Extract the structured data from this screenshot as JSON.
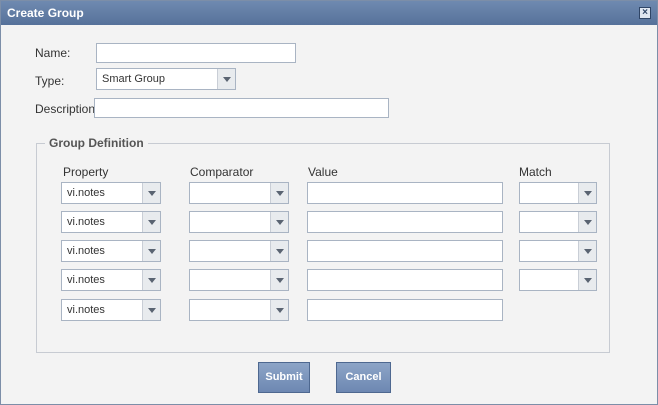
{
  "dialog": {
    "title": "Create Group",
    "close_icon": "close-icon"
  },
  "form": {
    "name_label": "Name:",
    "name_value": "",
    "type_label": "Type:",
    "type_value": "Smart Group",
    "description_label": "Description",
    "description_value": ""
  },
  "group_definition": {
    "legend": "Group Definition",
    "headers": {
      "property": "Property",
      "comparator": "Comparator",
      "value": "Value",
      "match": "Match"
    },
    "rows": [
      {
        "property": "vi.notes",
        "comparator": "",
        "value": "",
        "match": ""
      },
      {
        "property": "vi.notes",
        "comparator": "",
        "value": "",
        "match": ""
      },
      {
        "property": "vi.notes",
        "comparator": "",
        "value": "",
        "match": ""
      },
      {
        "property": "vi.notes",
        "comparator": "",
        "value": "",
        "match": ""
      },
      {
        "property": "vi.notes",
        "comparator": "",
        "value": ""
      }
    ]
  },
  "buttons": {
    "submit": "Submit",
    "cancel": "Cancel"
  }
}
